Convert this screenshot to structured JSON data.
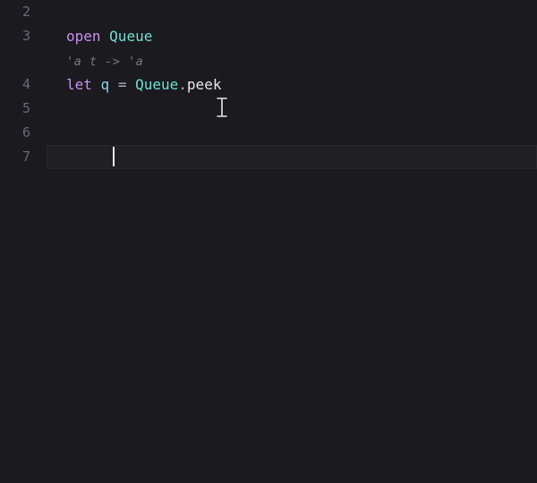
{
  "gutter": {
    "lines": [
      "2",
      "3",
      "",
      "4",
      "5",
      "6",
      "7"
    ]
  },
  "code": {
    "line3": {
      "kw": "open",
      "sp": " ",
      "mod": "Queue"
    },
    "hint": "'a t -> 'a",
    "line4": {
      "kw": "let",
      "sp1": " ",
      "id": "q",
      "sp2": " ",
      "eq": "=",
      "sp3": " ",
      "mod": "Queue",
      "dot": ".",
      "fn": "peek"
    }
  },
  "cursor": {
    "line": 7,
    "col": 0
  },
  "pointer": {
    "type": "ibeam"
  }
}
